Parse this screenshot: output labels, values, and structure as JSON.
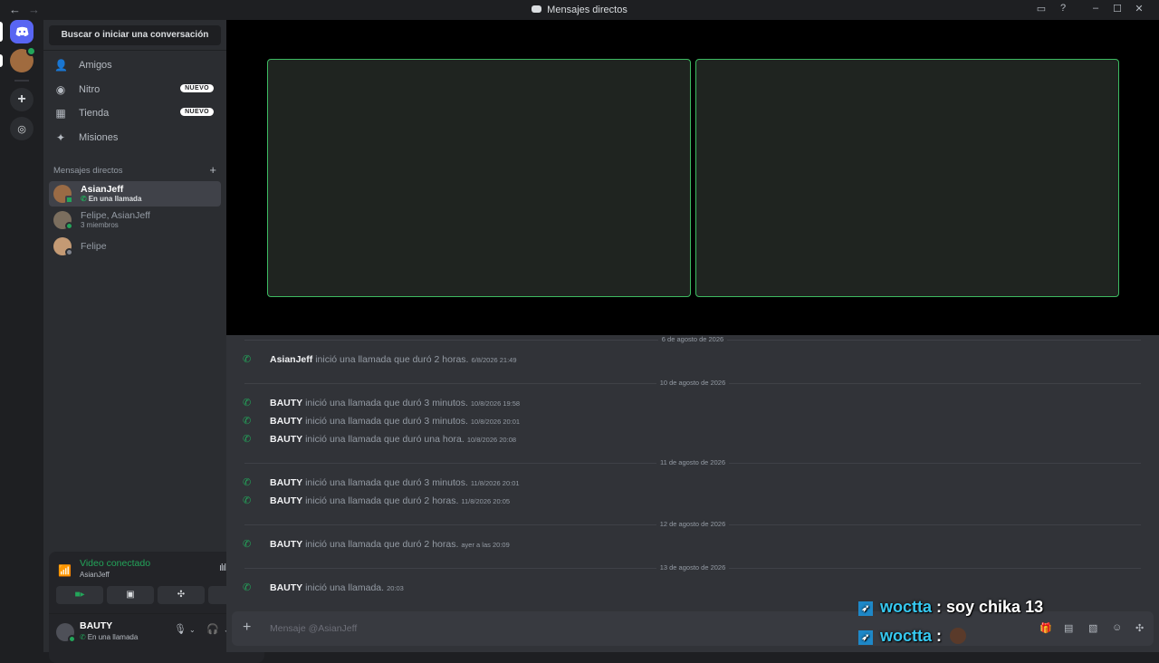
{
  "window": {
    "title": "Mensajes directos",
    "back_glyph": "←",
    "forward_glyph": "→"
  },
  "guilds": {
    "home_icon": "discord-icon",
    "add_icon": "+",
    "explore_icon": "compass-icon"
  },
  "sidebar": {
    "search_label": "Buscar o iniciar una conversación",
    "nav": [
      {
        "label": "Amigos",
        "icon": "friends-icon",
        "badge": ""
      },
      {
        "label": "Nitro",
        "icon": "nitro-icon",
        "badge": "NUEVO"
      },
      {
        "label": "Tienda",
        "icon": "shop-icon",
        "badge": "NUEVO"
      },
      {
        "label": "Misiones",
        "icon": "quests-icon",
        "badge": ""
      }
    ],
    "dm_header": "Mensajes directos",
    "dms": [
      {
        "name": "AsianJeff",
        "sub": "En una llamada",
        "active": true
      },
      {
        "name": "Felipe, AsianJeff",
        "sub": "3 miembros"
      },
      {
        "name": "Felipe",
        "sub": ""
      }
    ]
  },
  "voice": {
    "title": "Video conectado",
    "channel": "AsianJeff"
  },
  "user": {
    "name": "BAUTY",
    "status": "En una llamada"
  },
  "messages": {
    "dividers": [
      "6 de agosto de 2026",
      "10 de agosto de 2026",
      "11 de agosto de 2026",
      "12 de agosto de 2026",
      "13 de agosto de 2026"
    ],
    "items": [
      {
        "who": "AsianJeff",
        "text": "inició una llamada que duró 2 horas.",
        "ts": "6/8/2026 21:49"
      },
      {
        "who": "BAUTY",
        "text": "inició una llamada que duró 3 minutos.",
        "ts": "10/8/2026 19:58"
      },
      {
        "who": "BAUTY",
        "text": "inició una llamada que duró 3 minutos.",
        "ts": "10/8/2026 20:01"
      },
      {
        "who": "BAUTY",
        "text": "inició una llamada que duró una hora.",
        "ts": "10/8/2026 20:08"
      },
      {
        "who": "BAUTY",
        "text": "inició una llamada que duró 3 minutos.",
        "ts": "11/8/2026 20:01"
      },
      {
        "who": "BAUTY",
        "text": "inició una llamada que duró 2 horas.",
        "ts": "11/8/2026 20:05"
      },
      {
        "who": "BAUTY",
        "text": "inició una llamada que duró 2 horas.",
        "ts": "ayer a las 20:09"
      },
      {
        "who": "BAUTY",
        "text": "inició una llamada.",
        "ts": "20:03"
      }
    ]
  },
  "composer": {
    "placeholder": "Mensaje @AsianJeff"
  },
  "overlay": {
    "lines": [
      {
        "user": "woctta",
        "sep": " : ",
        "text": "soy chika 13"
      },
      {
        "user": "woctta",
        "sep": " : ",
        "text": ""
      }
    ]
  },
  "colors": {
    "accent": "#5865f2",
    "online": "#23a55a",
    "tile_border": "#3dbb61"
  }
}
